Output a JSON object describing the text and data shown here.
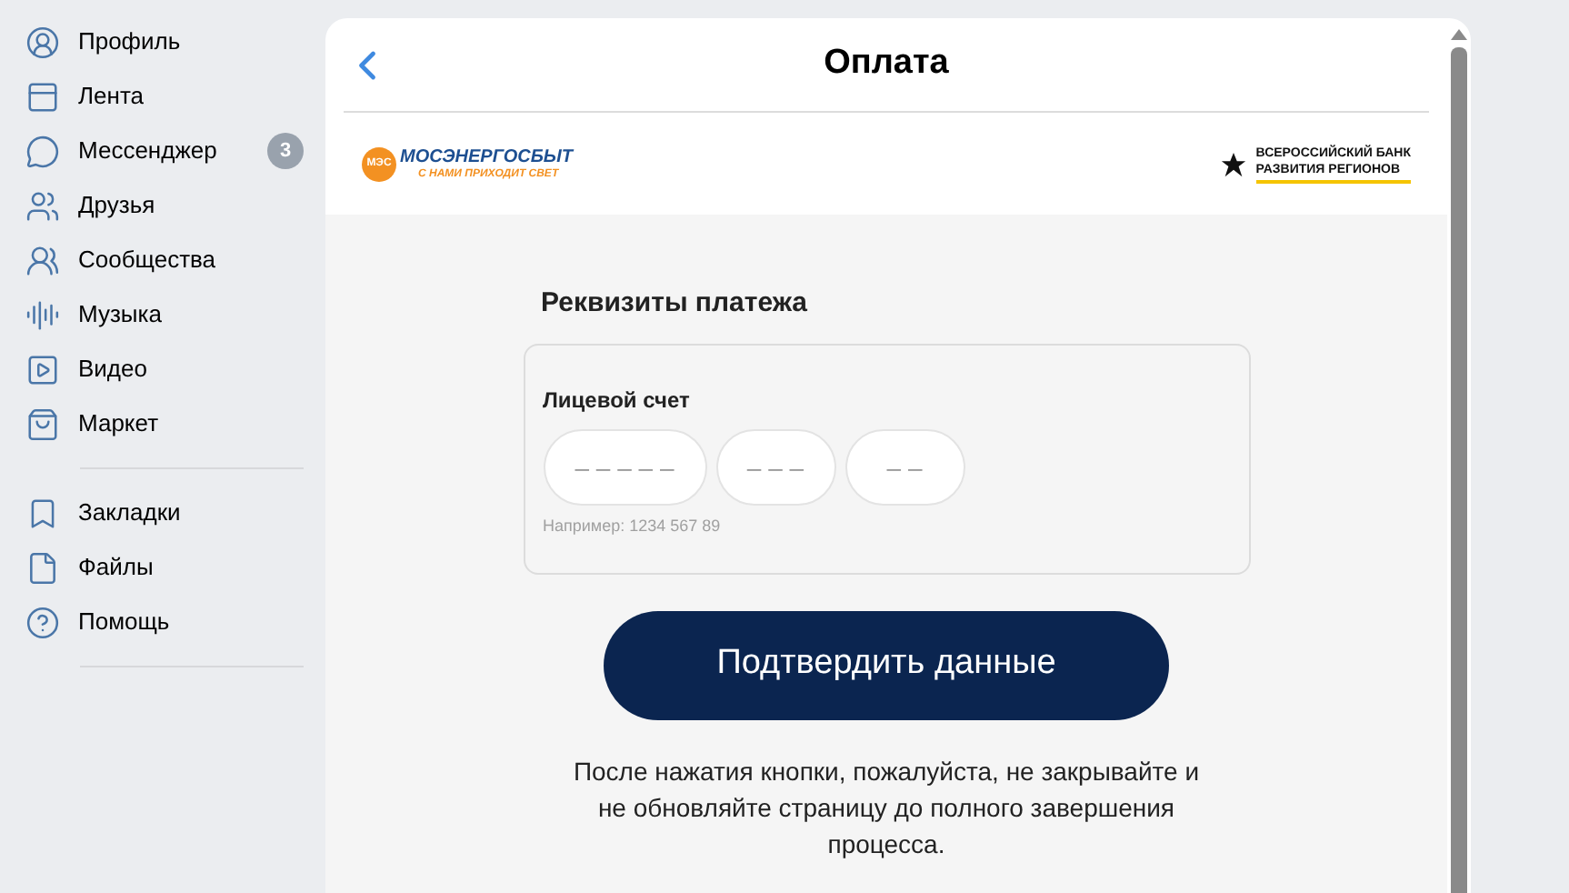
{
  "sidebar": {
    "groups": [
      {
        "items": [
          {
            "label": "Профиль"
          },
          {
            "label": "Лента"
          },
          {
            "label": "Мессенджер",
            "badge": "3"
          },
          {
            "label": "Друзья"
          },
          {
            "label": "Сообщества"
          },
          {
            "label": "Музыка"
          },
          {
            "label": "Видео"
          },
          {
            "label": "Маркет"
          }
        ]
      },
      {
        "items": [
          {
            "label": "Закладки"
          },
          {
            "label": "Файлы"
          },
          {
            "label": "Помощь"
          }
        ]
      }
    ]
  },
  "header": {
    "title": "Оплата"
  },
  "logos": {
    "left": {
      "mark": "МЭС",
      "name": "МОСЭНЕРГОСБЫТ",
      "slogan": "С НАМИ ПРИХОДИТ СВЕТ"
    },
    "right": {
      "line_1": "ВСЕРОССИЙСКИЙ БАНК",
      "line_2": "РАЗВИТИЯ РЕГИОНОВ"
    }
  },
  "form": {
    "title": "Реквизиты платежа",
    "field_label": "Лицевой счет",
    "fields": [
      {
        "placeholder": "– – – – –"
      },
      {
        "placeholder": "– – –"
      },
      {
        "placeholder": "– –"
      }
    ],
    "hint": "Например: 1234 567 89"
  },
  "submit": {
    "label": "Подтвердить данные"
  },
  "notice": "После нажатия кнопки, пожалуйста, не закрывайте и не обновляйте страницу до полного завершения процесса."
}
